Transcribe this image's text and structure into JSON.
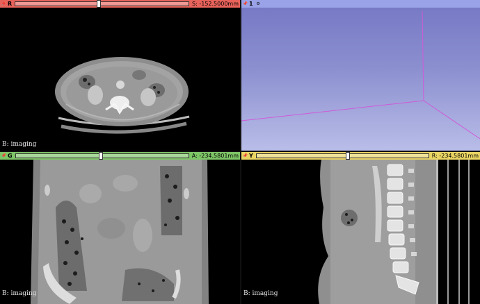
{
  "views": {
    "red": {
      "pin": "pin-icon",
      "label": "R",
      "offset": "S: -152.5000mm",
      "slider_fraction": 0.47,
      "overlay": "B: imaging"
    },
    "three_d": {
      "pin": "pin-icon",
      "label": "1",
      "extra_icon": "views-icon"
    },
    "green": {
      "pin": "pin-icon",
      "label": "G",
      "offset": "A: -234.5801mm",
      "slider_fraction": 0.48,
      "overlay": "B: imaging"
    },
    "yellow": {
      "pin": "pin-icon",
      "label": "Y",
      "offset": "R: -234.5801mm",
      "slider_fraction": 0.52,
      "overlay": "B: imaging"
    }
  },
  "colors": {
    "red": "#e8635b",
    "green": "#7dc466",
    "yellow": "#e9d463",
    "three_d": "#9aa3e8",
    "bounding_box": "#d05ad8"
  }
}
